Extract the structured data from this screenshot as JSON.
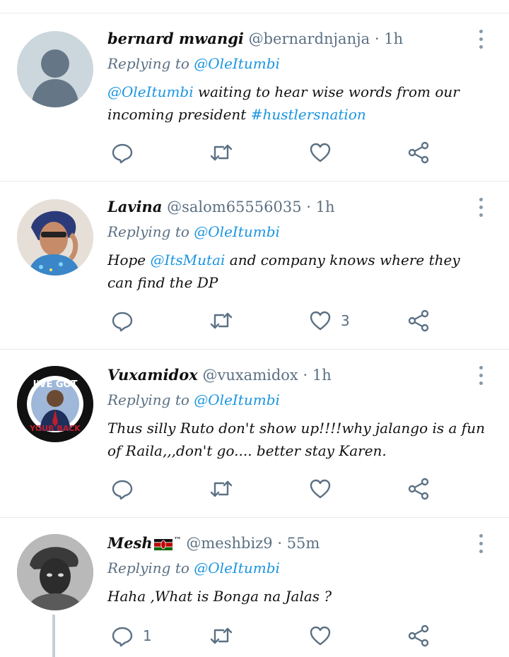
{
  "colors": {
    "accent": "#1b95e0",
    "muted": "#5b7083",
    "divider": "#e6ecf0"
  },
  "icons": {
    "reply": "reply-icon",
    "retweet": "retweet-icon",
    "like": "heart-icon",
    "share": "share-icon",
    "more": "more-options-icon"
  },
  "tweets": [
    {
      "name": "bernard mwangi",
      "handle": "@bernardnjanja",
      "dot": "·",
      "time": "1h",
      "replying_prefix": "Replying to",
      "replying_to": "@OleItumbi",
      "text_mention": "@OleItumbi",
      "text_body": " waiting to hear wise words from our incoming president ",
      "text_hashtag": "#hustlersnation",
      "reply_count": "",
      "like_count": ""
    },
    {
      "name": "Lavina",
      "handle": "@salom65556035",
      "dot": "·",
      "time": "1h",
      "replying_prefix": "Replying to",
      "replying_to": "@OleItumbi",
      "text_pre": "Hope ",
      "text_mention": "@ItsMutai",
      "text_post": " and company knows where they can find the DP",
      "reply_count": "",
      "like_count": "3"
    },
    {
      "name": "Vuxamidox",
      "handle": "@vuxamidox",
      "dot": "·",
      "time": "1h",
      "replying_prefix": "Replying to",
      "replying_to": "@OleItumbi",
      "text": "Thus silly Ruto don't show up!!!!why jalango is a fun of Raila,,,don't go.... better stay Karen.",
      "avatar_top": "I'VE GOT",
      "avatar_bottom": "YOUR BACK",
      "reply_count": "",
      "like_count": ""
    },
    {
      "name": "Mesh",
      "name_sup": "™",
      "handle": "@meshbiz9",
      "dot": "·",
      "time": "55m",
      "replying_prefix": "Replying to",
      "replying_to": "@OleItumbi",
      "text": "Haha ,What is Bonga na Jalas ?",
      "reply_count": "1",
      "like_count": ""
    }
  ]
}
